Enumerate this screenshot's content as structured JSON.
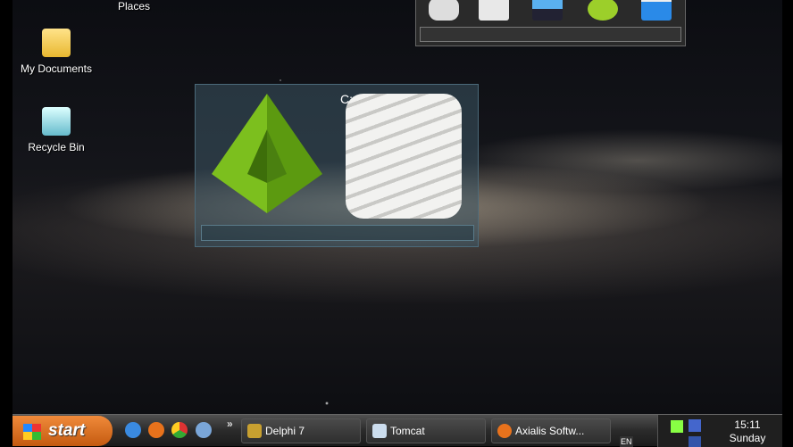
{
  "desktop": {
    "icons": [
      {
        "label": "Places"
      },
      {
        "label": "My Documents"
      },
      {
        "label": "Recycle Bin"
      }
    ],
    "drive_gadget": {
      "drive_label": "C:"
    },
    "dock_icons": [
      "robot-icon",
      "document-icon",
      "picture-icon",
      "music-icon",
      "video-icon"
    ]
  },
  "taskbar": {
    "start_label": "start",
    "overflow": "»",
    "quick_launch": [
      "internet-explorer-icon",
      "firefox-icon",
      "chrome-icon",
      "browser-icon"
    ],
    "tasks": [
      {
        "label": "Delphi 7"
      },
      {
        "label": "Tomcat"
      },
      {
        "label": "Axialis Softw..."
      }
    ],
    "language": "EN",
    "clock": {
      "time": "15:11",
      "day": "Sunday"
    }
  }
}
